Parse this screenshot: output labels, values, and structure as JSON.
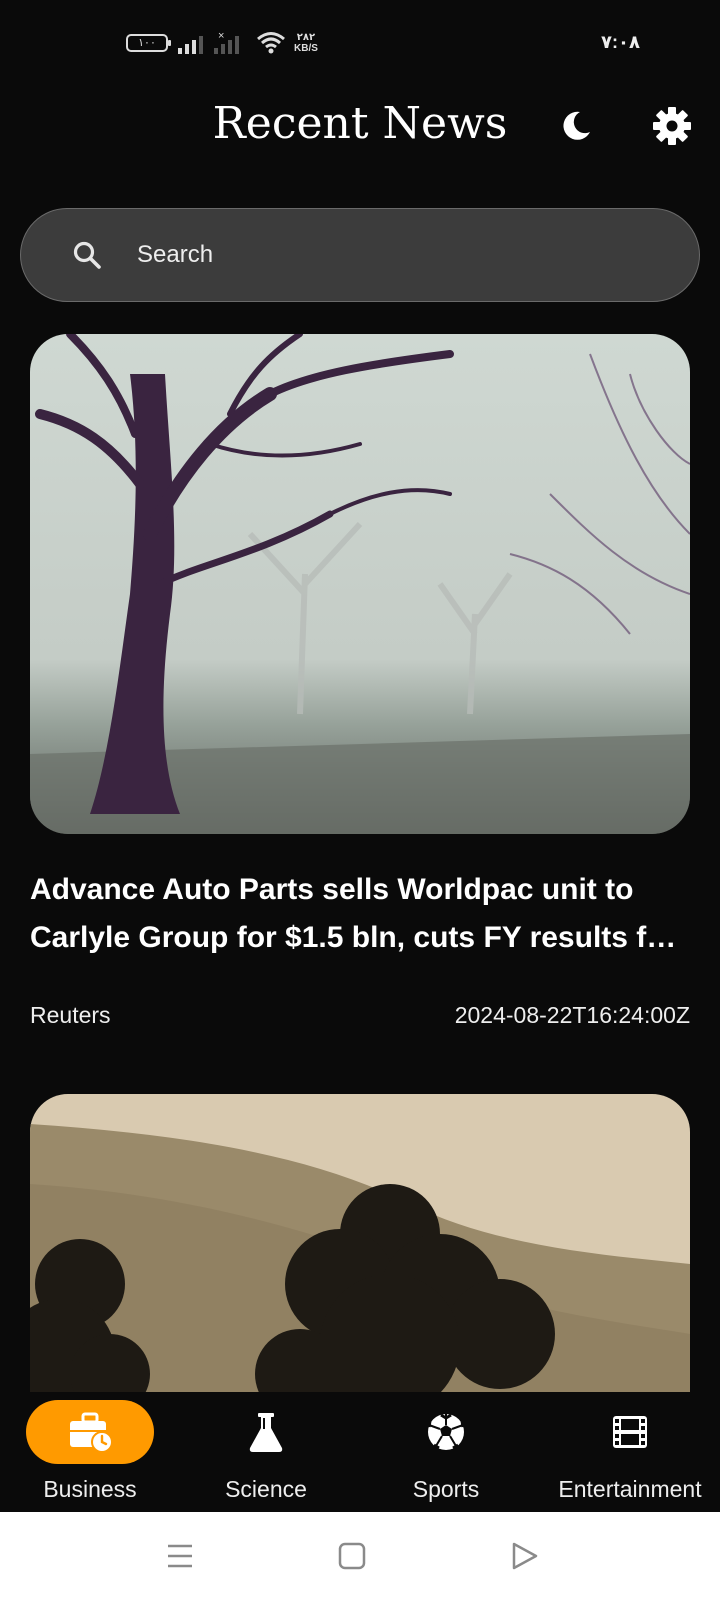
{
  "status_bar": {
    "battery": "١٠٠",
    "net_speed_value": "٢٨٢",
    "net_speed_unit": "KB/S",
    "time": "٧:٠٨"
  },
  "header": {
    "title": "Recent News",
    "theme_icon": "moon-icon",
    "settings_icon": "gear-icon"
  },
  "search": {
    "placeholder": "Search",
    "icon": "search-icon"
  },
  "articles": [
    {
      "title": "Advance Auto Parts sells Worldpac unit to Carlyle Group for $1.5 bln, cuts FY results f…",
      "source": "Reuters",
      "published": "2024-08-22T16:24:00Z"
    }
  ],
  "bottom_nav": {
    "items": [
      {
        "label": "Business",
        "icon": "briefcase-clock-icon",
        "active": true
      },
      {
        "label": "Science",
        "icon": "flask-icon",
        "active": false
      },
      {
        "label": "Sports",
        "icon": "soccer-ball-icon",
        "active": false
      },
      {
        "label": "Entertainment",
        "icon": "film-icon",
        "active": false
      }
    ]
  },
  "colors": {
    "background": "#0a0a0a",
    "accent": "#ff9a00",
    "search_bg": "#3c3c3c"
  }
}
